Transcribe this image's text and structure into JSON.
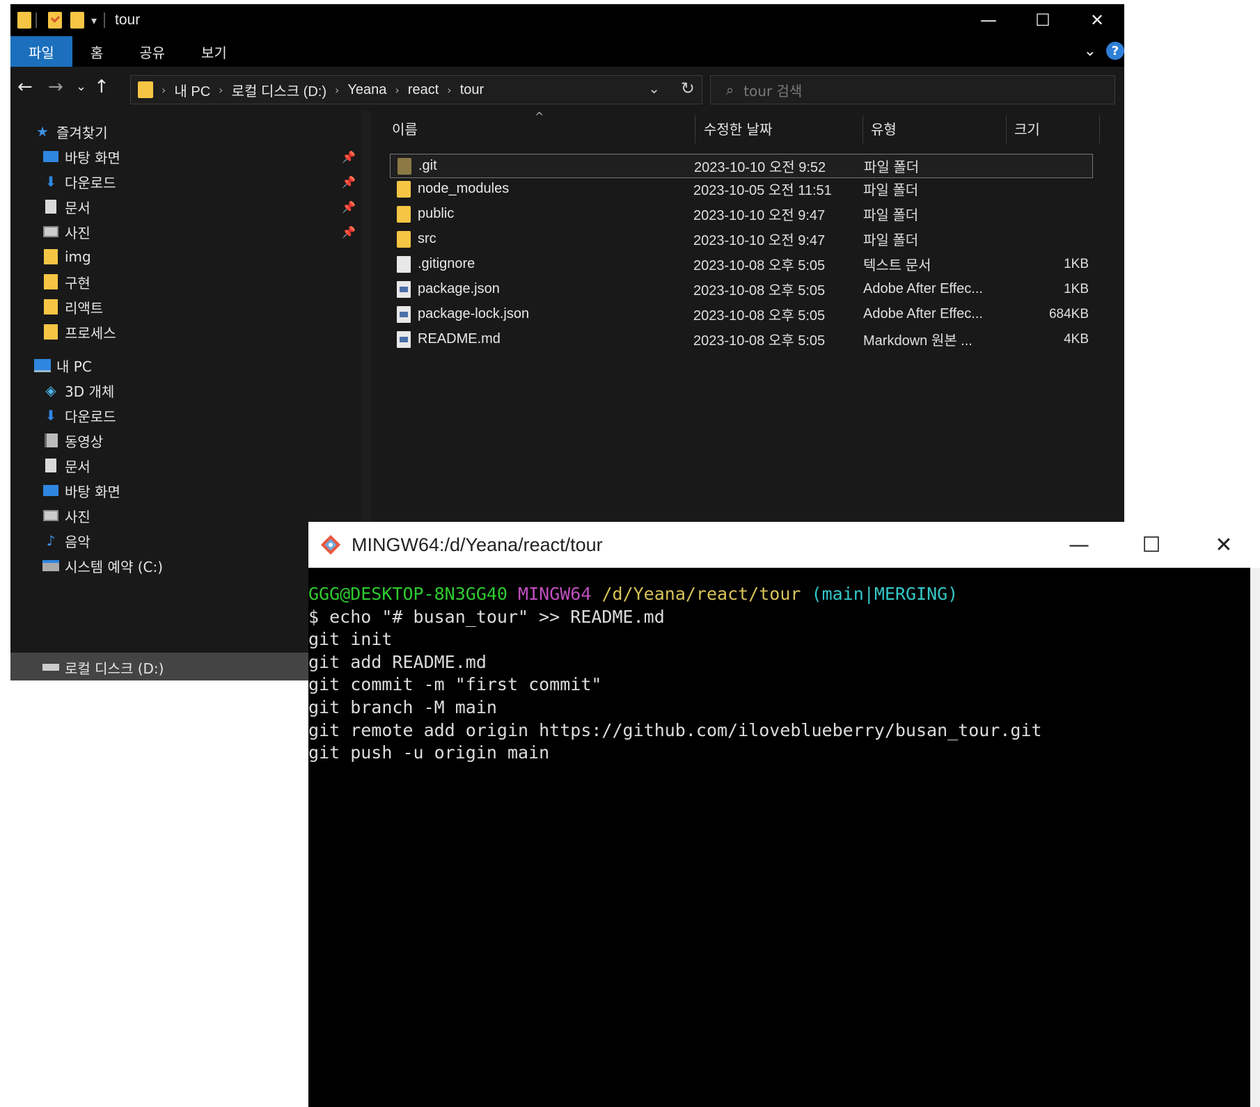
{
  "explorer": {
    "window_title": "tour",
    "ribbon_tabs": [
      "파일",
      "홈",
      "공유",
      "보기"
    ],
    "breadcrumb": [
      "내 PC",
      "로컬 디스크 (D:)",
      "Yeana",
      "react",
      "tour"
    ],
    "search_placeholder": "tour 검색",
    "nav": {
      "quick_access": "즐겨찾기",
      "quick_items": [
        "바탕 화면",
        "다운로드",
        "문서",
        "사진",
        "img",
        "구현",
        "리액트",
        "프로세스"
      ],
      "this_pc": "내 PC",
      "pc_items": [
        "3D 개체",
        "다운로드",
        "동영상",
        "문서",
        "바탕 화면",
        "사진",
        "음악",
        "시스템 예약 (C:)",
        "로컬 디스크 (D:)"
      ]
    },
    "columns": {
      "name": "이름",
      "date": "수정한 날짜",
      "type": "유형",
      "size": "크기"
    },
    "files": [
      {
        "name": ".git",
        "date": "2023-10-10 오전 9:52",
        "type": "파일 폴더",
        "size": ""
      },
      {
        "name": "node_modules",
        "date": "2023-10-05 오전 11:51",
        "type": "파일 폴더",
        "size": ""
      },
      {
        "name": "public",
        "date": "2023-10-10 오전 9:47",
        "type": "파일 폴더",
        "size": ""
      },
      {
        "name": "src",
        "date": "2023-10-10 오전 9:47",
        "type": "파일 폴더",
        "size": ""
      },
      {
        "name": ".gitignore",
        "date": "2023-10-08 오후 5:05",
        "type": "텍스트 문서",
        "size": "1KB"
      },
      {
        "name": "package.json",
        "date": "2023-10-08 오후 5:05",
        "type": "Adobe After Effec...",
        "size": "1KB"
      },
      {
        "name": "package-lock.json",
        "date": "2023-10-08 오후 5:05",
        "type": "Adobe After Effec...",
        "size": "684KB"
      },
      {
        "name": "README.md",
        "date": "2023-10-08 오후 5:05",
        "type": "Markdown 원본 ...",
        "size": "4KB"
      }
    ]
  },
  "terminal": {
    "window_title": "MINGW64:/d/Yeana/react/tour",
    "prompt": {
      "user_host": "GGG@DESKTOP-8N3GG40",
      "system": "MINGW64",
      "path": "/d/Yeana/react/tour",
      "branch": "(main|MERGING)"
    },
    "lines": [
      "$ echo \"# busan_tour\" >> README.md",
      "git init",
      "git add README.md",
      "git commit -m \"first commit\"",
      "git branch -M main",
      "git remote add origin https://github.com/iloveblueberry/busan_tour.git",
      "git push -u origin main"
    ]
  }
}
